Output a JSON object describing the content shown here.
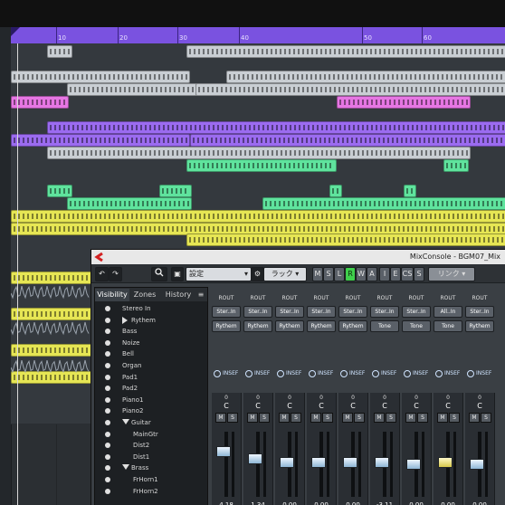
{
  "ruler": {
    "markers": [
      "10",
      "20",
      "30",
      "40",
      "50",
      "60"
    ]
  },
  "arrange": {
    "colors": {
      "purple": "#9b6bf0",
      "gray": "#c9ced3",
      "pink": "#e676e3",
      "green": "#5fe39d",
      "yellow": "#e6e654",
      "track_bg": "#34393e"
    }
  },
  "mixconsole": {
    "title": "MixConsole - BGM07_Mix",
    "toolbar": {
      "settings_label": "設定",
      "rack_label": "ラック",
      "mode_buttons": [
        "M",
        "S",
        "L",
        "R",
        "W",
        "A"
      ],
      "view_buttons": [
        "I",
        "E",
        "CS",
        "S"
      ],
      "link_label": "リンク"
    },
    "tabs": [
      "Visibility",
      "Zones",
      "History"
    ],
    "visibility_items": [
      {
        "label": "Stereo In",
        "type": "item"
      },
      {
        "label": "Rythem",
        "type": "folder-collapsed"
      },
      {
        "label": "Bass",
        "type": "item"
      },
      {
        "label": "Noize",
        "type": "item"
      },
      {
        "label": "Bell",
        "type": "item"
      },
      {
        "label": "Organ",
        "type": "item"
      },
      {
        "label": "Pad1",
        "type": "item"
      },
      {
        "label": "Pad2",
        "type": "item"
      },
      {
        "label": "Piano1",
        "type": "item"
      },
      {
        "label": "Piano2",
        "type": "item"
      },
      {
        "label": "Guitar",
        "type": "folder-expanded"
      },
      {
        "label": "MainGtr",
        "type": "child"
      },
      {
        "label": "Dist2",
        "type": "child"
      },
      {
        "label": "Dist1",
        "type": "child"
      },
      {
        "label": "Brass",
        "type": "folder-expanded"
      },
      {
        "label": "FrHorn1",
        "type": "child"
      },
      {
        "label": "FrHorn2",
        "type": "child"
      }
    ],
    "routing_label": "ROUT",
    "inputs": [
      "Ster..In",
      "Ster..In",
      "Ster..In",
      "Ster..In",
      "Ster..In",
      "Ster..In",
      "Ster..In",
      "All..In",
      "Ster..In"
    ],
    "outputs": [
      "Rythem",
      "Rythem",
      "Rythem",
      "Rythem",
      "Rythem",
      "Tone",
      "Tone",
      "Tone",
      "Rythem"
    ],
    "insert_label": "INSEF",
    "pan_value": "C",
    "pan_db": "0",
    "volumes": [
      "4.18",
      "1.34",
      "0.00",
      "0.00",
      "0.00",
      "-3.11",
      "0.00",
      "0.00",
      "0.00"
    ],
    "fader_levels": [
      0.75,
      0.62,
      0.55,
      0.55,
      0.55,
      0.55,
      0.52,
      0.55,
      0.52
    ]
  }
}
